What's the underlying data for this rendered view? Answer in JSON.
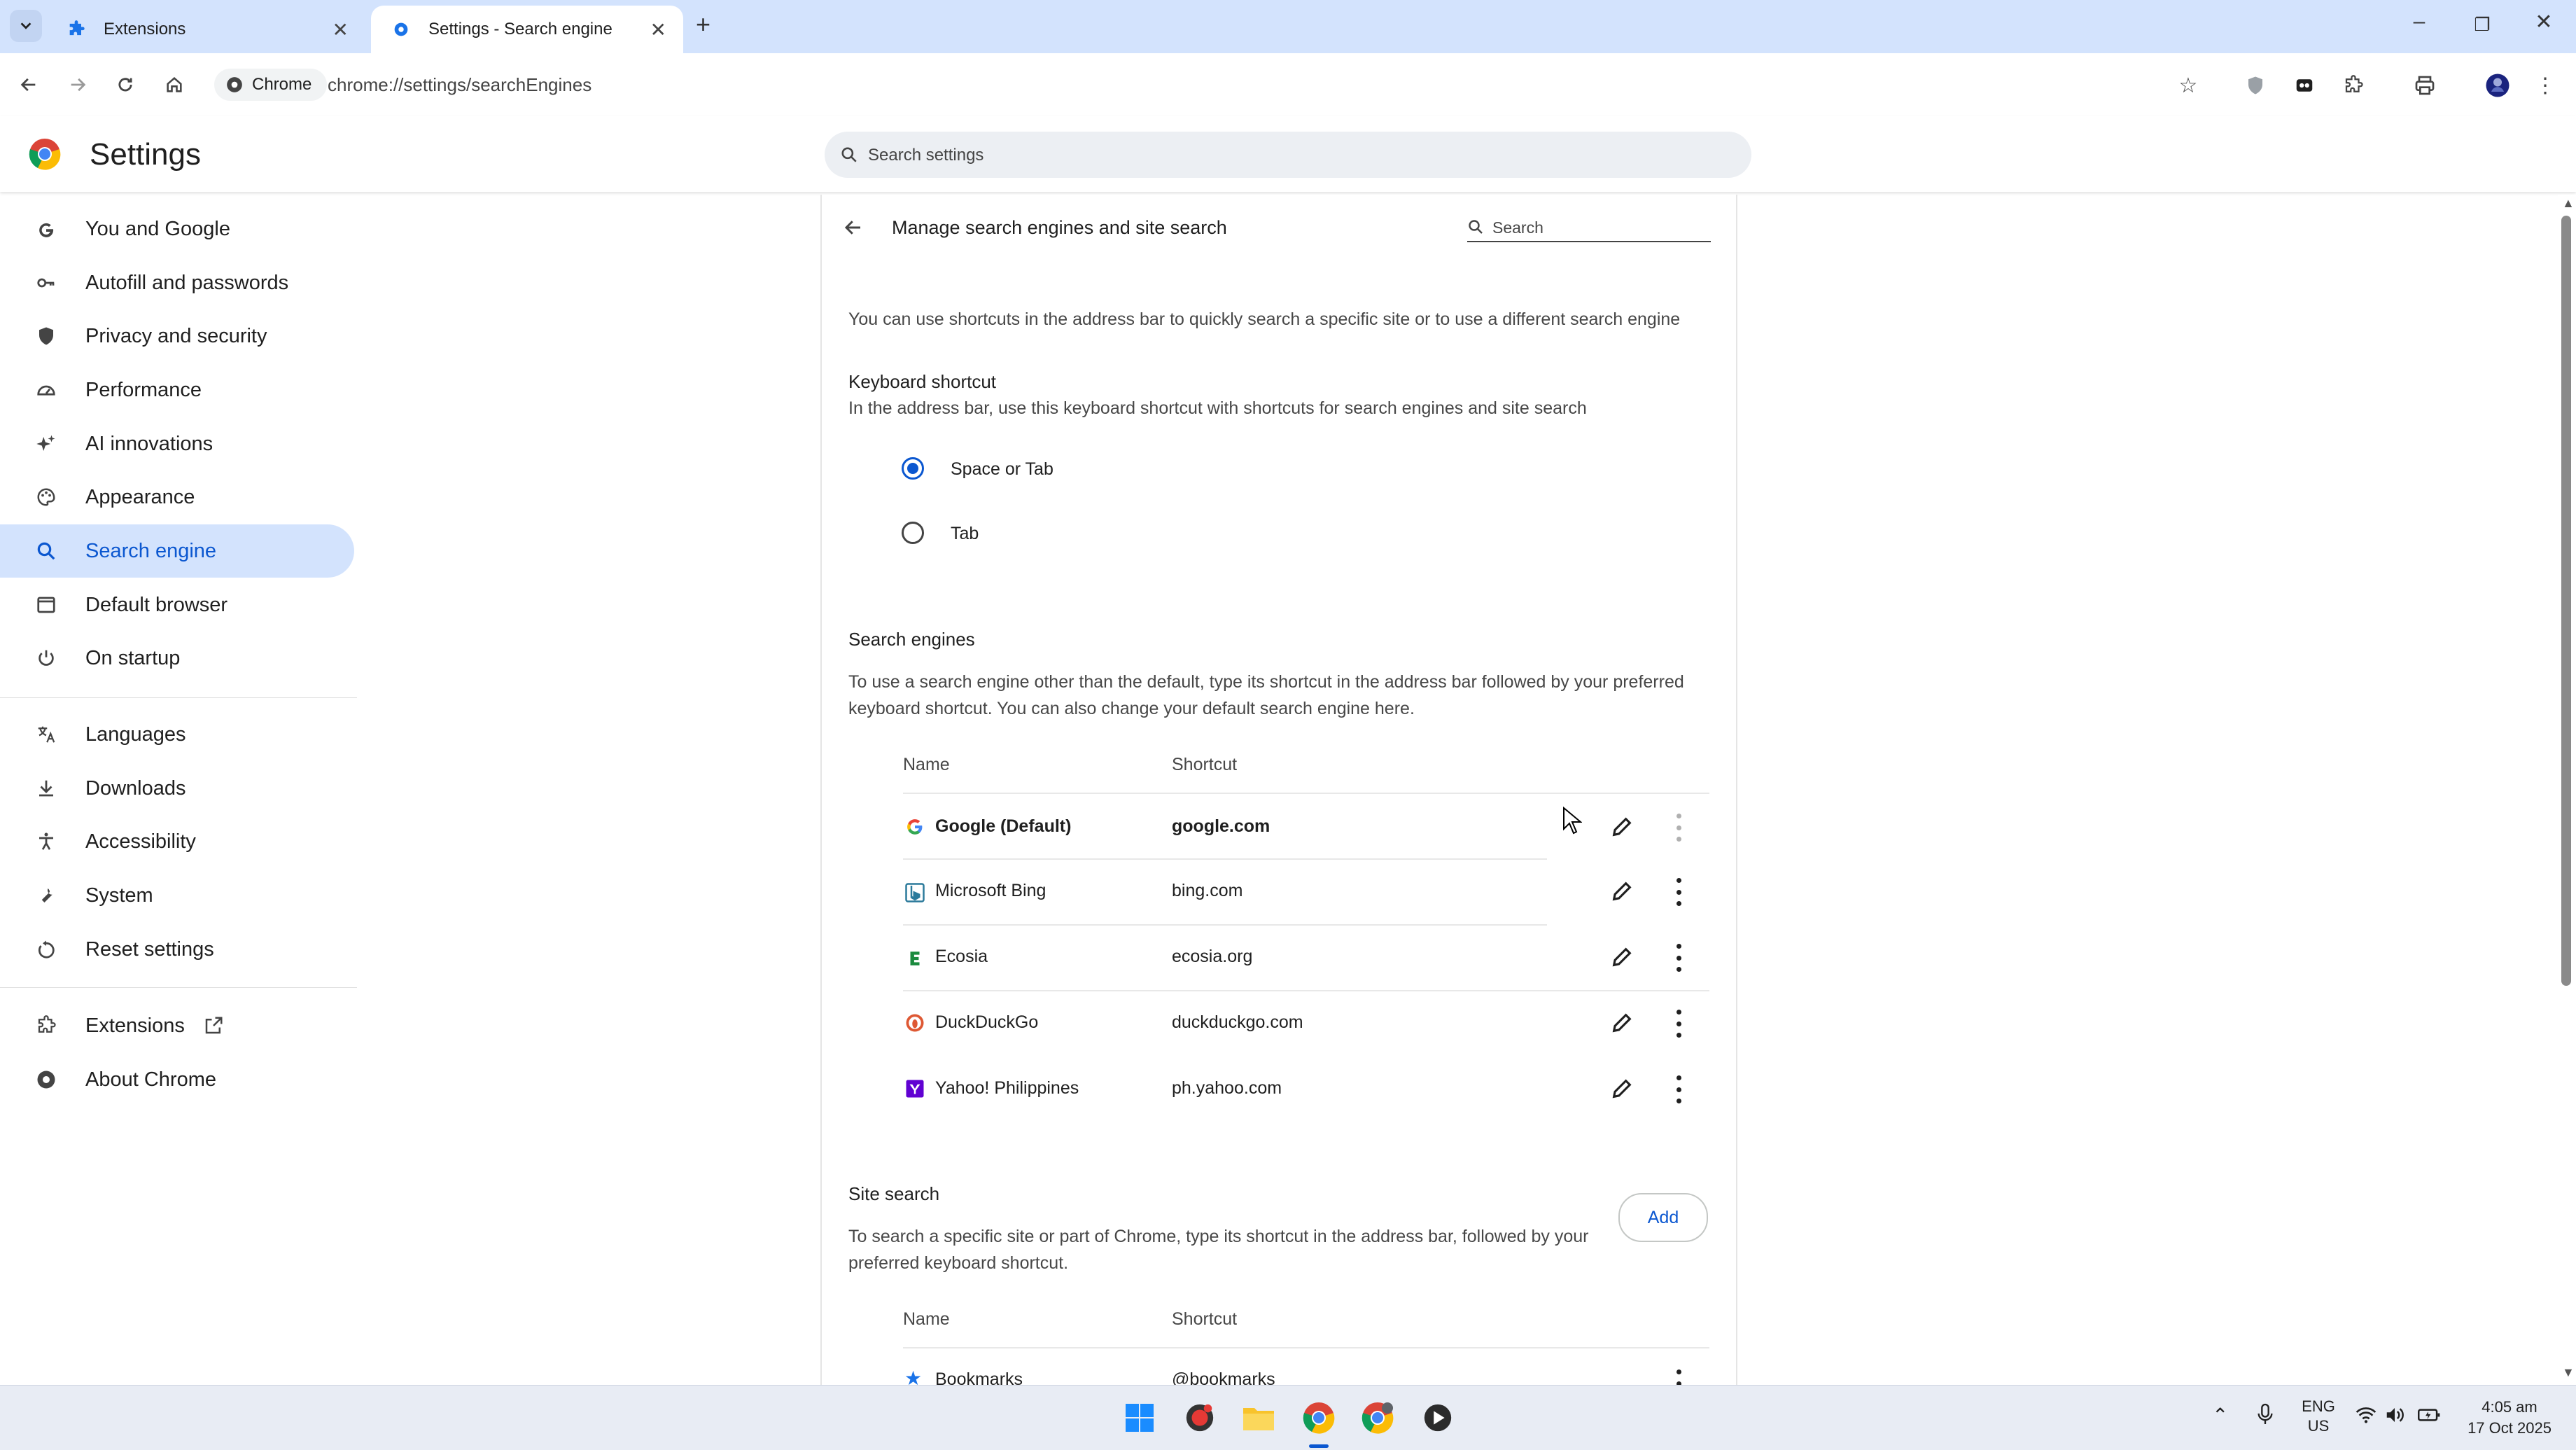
{
  "tabs": [
    {
      "label": "Extensions",
      "icon": "puzzle-icon"
    },
    {
      "label": "Settings - Search engine",
      "icon": "gear-icon",
      "active": true
    }
  ],
  "toolbar": {
    "chip_label": "Chrome",
    "url": "chrome://settings/searchEngines"
  },
  "settings": {
    "title": "Settings",
    "search_placeholder": "Search settings"
  },
  "sidebar": {
    "items": [
      {
        "label": "You and Google",
        "icon": "google-g-icon"
      },
      {
        "label": "Autofill and passwords",
        "icon": "key-icon"
      },
      {
        "label": "Privacy and security",
        "icon": "shield-icon"
      },
      {
        "label": "Performance",
        "icon": "speedometer-icon"
      },
      {
        "label": "AI innovations",
        "icon": "sparkle-icon"
      },
      {
        "label": "Appearance",
        "icon": "palette-icon"
      },
      {
        "label": "Search engine",
        "icon": "search-icon",
        "active": true
      },
      {
        "label": "Default browser",
        "icon": "browser-icon"
      },
      {
        "label": "On startup",
        "icon": "power-icon"
      },
      {
        "label": "Languages",
        "icon": "translate-icon"
      },
      {
        "label": "Downloads",
        "icon": "download-icon"
      },
      {
        "label": "Accessibility",
        "icon": "accessibility-icon"
      },
      {
        "label": "System",
        "icon": "wrench-icon"
      },
      {
        "label": "Reset settings",
        "icon": "reset-icon"
      },
      {
        "label": "Extensions",
        "icon": "puzzle-icon"
      },
      {
        "label": "About Chrome",
        "icon": "chrome-icon"
      }
    ]
  },
  "page": {
    "header": "Manage search engines and site search",
    "search_placeholder": "Search",
    "intro": "You can use shortcuts in the address bar to quickly search a specific site or to use a different search engine",
    "keyboard": {
      "title": "Keyboard shortcut",
      "desc": "In the address bar, use this keyboard shortcut with shortcuts for search engines and site search",
      "options": [
        {
          "label": "Space or Tab",
          "selected": true
        },
        {
          "label": "Tab",
          "selected": false
        }
      ]
    },
    "engines": {
      "title": "Search engines",
      "desc_line1": "To use a search engine other than the default, type its shortcut in the address bar followed by your preferred",
      "desc_line2": "keyboard shortcut. You can also change your default search engine here.",
      "col_name": "Name",
      "col_shortcut": "Shortcut",
      "rows": [
        {
          "name": "Google (Default)",
          "shortcut": "google.com",
          "icon": "google-icon",
          "bold": true
        },
        {
          "name": "Microsoft Bing",
          "shortcut": "bing.com",
          "icon": "bing-icon"
        },
        {
          "name": "Ecosia",
          "shortcut": "ecosia.org",
          "icon": "ecosia-icon"
        },
        {
          "name": "DuckDuckGo",
          "shortcut": "duckduckgo.com",
          "icon": "duckduckgo-icon"
        },
        {
          "name": "Yahoo! Philippines",
          "shortcut": "ph.yahoo.com",
          "icon": "yahoo-icon"
        }
      ]
    },
    "site_search": {
      "title": "Site search",
      "add_label": "Add",
      "desc_line1": "To search a specific site or part of Chrome, type its shortcut in the address bar, followed by your",
      "desc_line2": "preferred keyboard shortcut.",
      "col_name": "Name",
      "col_shortcut": "Shortcut",
      "rows": [
        {
          "name": "Bookmarks",
          "shortcut": "@bookmarks",
          "icon": "star-icon"
        }
      ]
    }
  },
  "taskbar": {
    "lang": "ENG",
    "region": "US",
    "time": "4:05 am",
    "date": "17 Oct 2025"
  },
  "colors": {
    "accent": "#0b57d0",
    "tabbar": "#d3e3fd",
    "active_nav": "#d3e3fd"
  }
}
